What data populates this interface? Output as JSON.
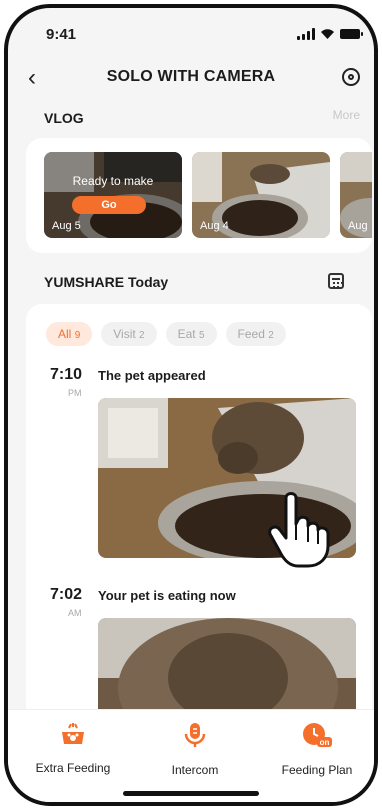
{
  "status": {
    "time": "9:41"
  },
  "header": {
    "title": "SOLO WITH CAMERA"
  },
  "vlog": {
    "label": "VLOG",
    "more": "More",
    "items": [
      {
        "date": "Aug 5",
        "overlay": "Ready to make",
        "button": "Go"
      },
      {
        "date": "Aug 4"
      },
      {
        "date": "Aug"
      }
    ]
  },
  "today": {
    "label": "YUMSHARE Today"
  },
  "filters": [
    {
      "label": "All",
      "count": "9",
      "active": true
    },
    {
      "label": "Visit",
      "count": "2"
    },
    {
      "label": "Eat",
      "count": "5"
    },
    {
      "label": "Feed",
      "count": "2"
    }
  ],
  "events": [
    {
      "time": "7:10",
      "ampm": "PM",
      "title": "The pet appeared"
    },
    {
      "time": "7:02",
      "ampm": "AM",
      "title": "Your pet is eating now"
    }
  ],
  "tabs": [
    {
      "label": "Extra Feeding",
      "icon": "bowl-icon"
    },
    {
      "label": "Intercom",
      "icon": "microphone-icon"
    },
    {
      "label": "Feeding Plan",
      "icon": "clock-on-icon"
    }
  ],
  "colors": {
    "accent": "#f56f2c",
    "background": "#f5f5f5"
  }
}
